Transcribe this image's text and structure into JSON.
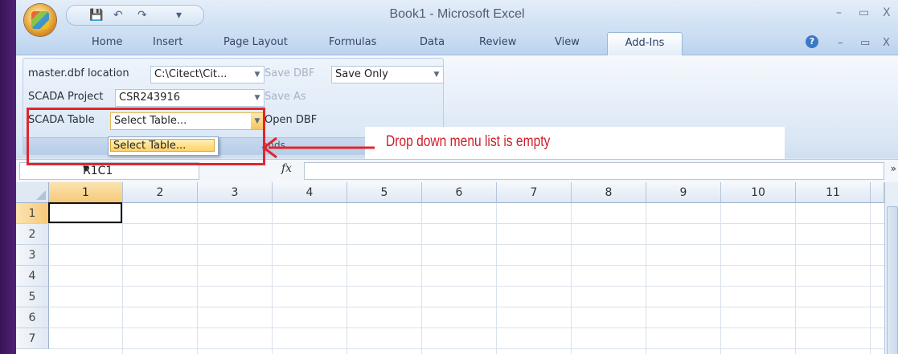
{
  "window": {
    "title": "Book1 - Microsoft Excel",
    "controls": {
      "minimize": "–",
      "maximize": "▭",
      "close": "X"
    }
  },
  "qat": {
    "save": "💾",
    "undo": "↶",
    "redo": "↷",
    "customize": "▾"
  },
  "tabs": [
    "Home",
    "Insert",
    "Page Layout",
    "Formulas",
    "Data",
    "Review",
    "View",
    "Add-Ins"
  ],
  "active_tab": "Add-Ins",
  "ribbon_controls": {
    "help": "?",
    "minimize": "–",
    "restore": "▭",
    "close": "X"
  },
  "ribbon": {
    "master_label": "master.dbf location",
    "master_value": "C:\\Citect\\Cit...",
    "save_dbf": "Save DBF",
    "save_only": "Save Only",
    "project_label": "SCADA Project",
    "project_value": "CSR243916",
    "save_as": "Save As",
    "table_label": "SCADA Table",
    "table_value": "Select Table...",
    "open_dbf": "Open DBF",
    "group_name": "ands",
    "dropdown_item": "Select Table..."
  },
  "annotation": {
    "text": "Drop down menu list is empty",
    "color": "#e0262b"
  },
  "formula_bar": {
    "name_box": "R1C1",
    "fx": "fx",
    "value": ""
  },
  "sheet": {
    "columns": [
      "1",
      "2",
      "3",
      "4",
      "5",
      "6",
      "7",
      "8",
      "9",
      "10",
      "11"
    ],
    "rows": [
      "1",
      "2",
      "3",
      "4",
      "5",
      "6",
      "7"
    ],
    "active_cell": "R1C1"
  }
}
